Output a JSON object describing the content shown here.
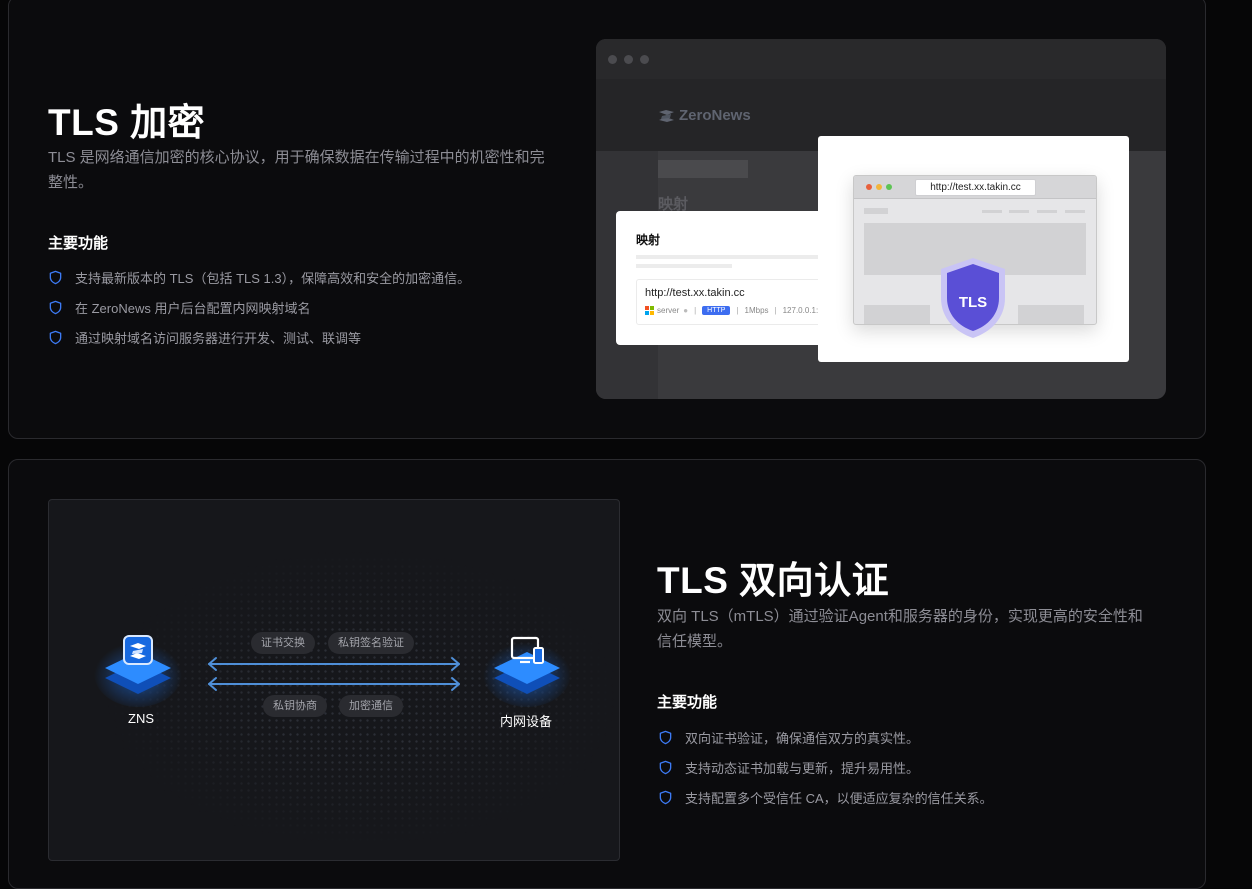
{
  "section1": {
    "title": "TLS 加密",
    "description": "TLS 是网络通信加密的核心协议，用于确保数据在传输过程中的机密性和完整性。",
    "features_heading": "主要功能",
    "features": [
      "支持最新版本的 TLS（包括 TLS 1.3），保障高效和安全的加密通信。",
      "在 ZeroNews 用户后台配置内网映射域名",
      "通过映射域名访问服务器进行开发、测试、联调等"
    ],
    "mockup": {
      "brand": "ZeroNews",
      "page_heading": "映射",
      "panel_title": "映射",
      "mapping_url": "http://test.xx.takin.cc",
      "server_label": "server",
      "protocol_badge": "HTTP",
      "bandwidth": "1Mbps",
      "local_address": "127.0.0.1:",
      "browser_url": "http://test.xx.takin.cc",
      "shield_label": "TLS"
    }
  },
  "section2": {
    "title": "TLS 双向认证",
    "description": "双向 TLS（mTLS）通过验证Agent和服务器的身份，实现更高的安全性和信任模型。",
    "features_heading": "主要功能",
    "features": [
      "双向证书验证，确保通信双方的真实性。",
      "支持动态证书加载与更新，提升易用性。",
      "支持配置多个受信任 CA，以便适应复杂的信任关系。"
    ],
    "diagram": {
      "left_node": "ZNS",
      "right_node": "内网设备",
      "top_pills": [
        "证书交换",
        "私钥签名验证"
      ],
      "bottom_pills": [
        "私钥协商",
        "加密通信"
      ]
    }
  },
  "colors": {
    "accent_blue": "#3d6df0",
    "shield_purple": "#5a4fd6",
    "node_glow": "#1f7bff",
    "arrow": "#4f8fd8"
  },
  "icons": [
    "shield-check-icon",
    "zeronews-logo-icon",
    "windows-icon",
    "monitor-icon",
    "tls-shield-icon"
  ]
}
